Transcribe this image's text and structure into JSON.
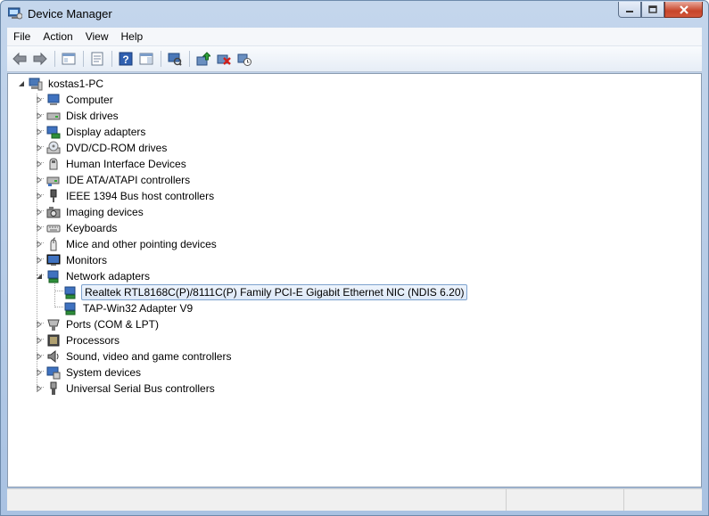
{
  "window": {
    "title": "Device Manager",
    "icon": "device-manager-icon"
  },
  "menu": [
    "File",
    "Action",
    "View",
    "Help"
  ],
  "toolbar": [
    "back-arrow-icon",
    "forward-arrow-icon",
    "show-hide-tree-icon",
    "properties-icon",
    "help-icon",
    "action-pane-icon",
    "scan-hardware-icon",
    "update-driver-icon",
    "uninstall-icon",
    "disable-device-icon"
  ],
  "tree": {
    "root": "kostas1-PC",
    "categories": [
      {
        "label": "Computer",
        "icon": "computer-icon"
      },
      {
        "label": "Disk drives",
        "icon": "disk-drive-icon"
      },
      {
        "label": "Display adapters",
        "icon": "display-adapter-icon"
      },
      {
        "label": "DVD/CD-ROM drives",
        "icon": "dvd-drive-icon"
      },
      {
        "label": "Human Interface Devices",
        "icon": "hid-icon"
      },
      {
        "label": "IDE ATA/ATAPI controllers",
        "icon": "ide-controller-icon"
      },
      {
        "label": "IEEE 1394 Bus host controllers",
        "icon": "firewire-icon"
      },
      {
        "label": "Imaging devices",
        "icon": "imaging-device-icon"
      },
      {
        "label": "Keyboards",
        "icon": "keyboard-icon"
      },
      {
        "label": "Mice and other pointing devices",
        "icon": "mouse-icon"
      },
      {
        "label": "Monitors",
        "icon": "monitor-icon"
      },
      {
        "label": "Network adapters",
        "icon": "network-adapter-icon",
        "expanded": true,
        "children": [
          {
            "label": "Realtek RTL8168C(P)/8111C(P) Family PCI-E Gigabit Ethernet NIC (NDIS 6.20)",
            "selected": true
          },
          {
            "label": "TAP-Win32 Adapter V9"
          }
        ]
      },
      {
        "label": "Ports (COM & LPT)",
        "icon": "port-icon"
      },
      {
        "label": "Processors",
        "icon": "processor-icon"
      },
      {
        "label": "Sound, video and game controllers",
        "icon": "sound-icon"
      },
      {
        "label": "System devices",
        "icon": "system-device-icon"
      },
      {
        "label": "Universal Serial Bus controllers",
        "icon": "usb-icon"
      }
    ]
  }
}
